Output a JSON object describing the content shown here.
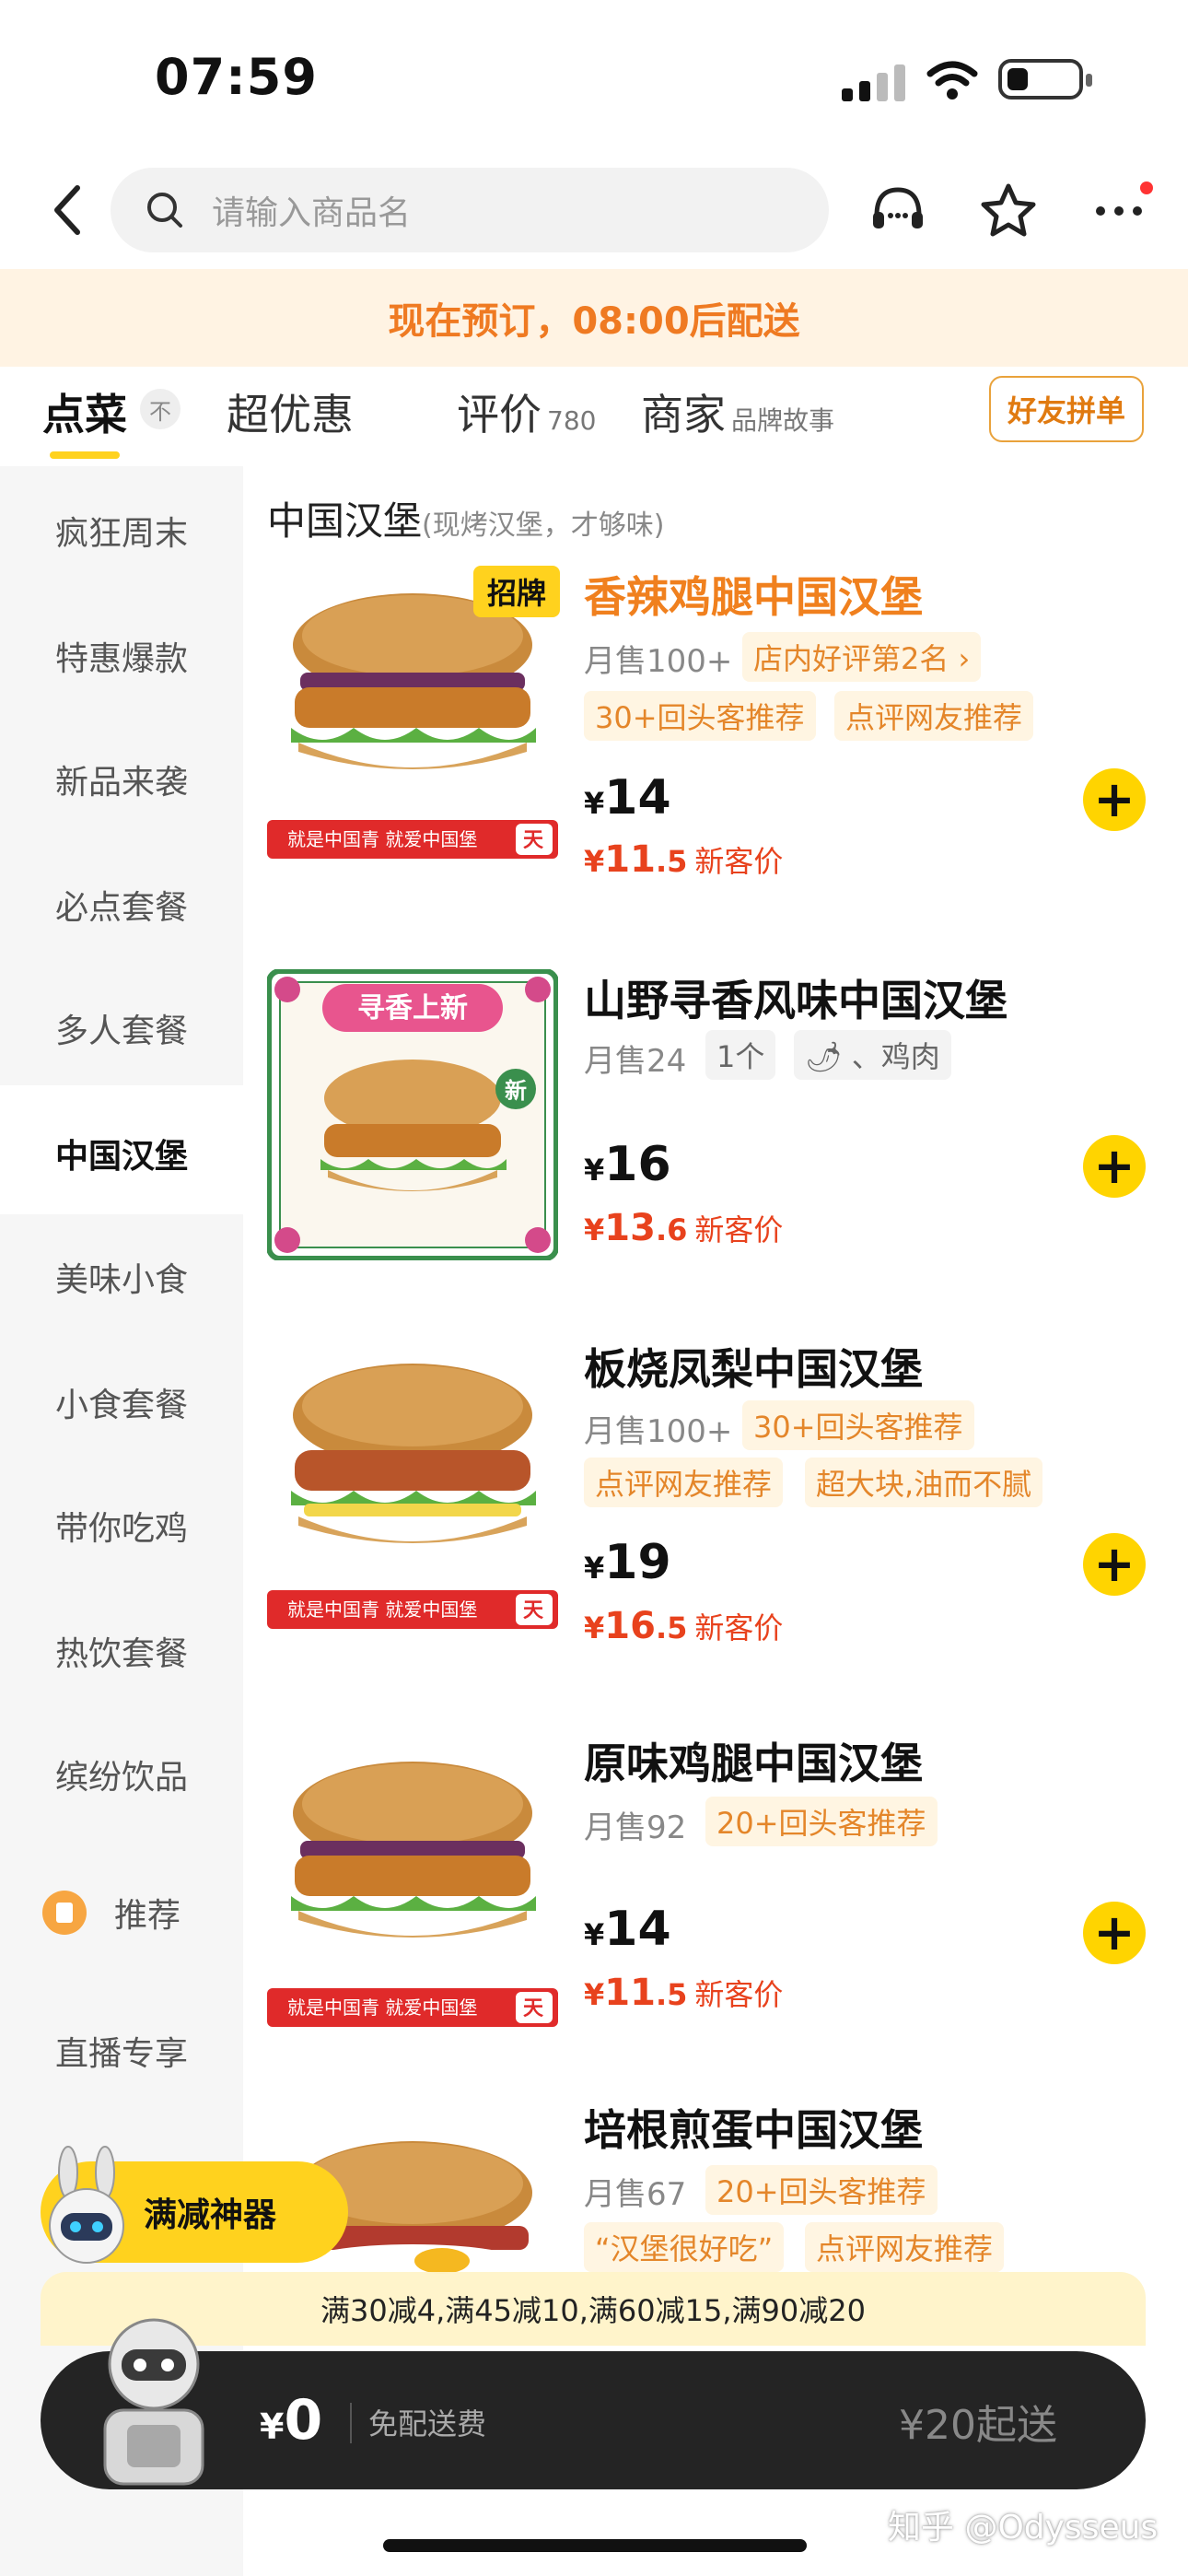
{
  "status_bar": {
    "time": "07:59"
  },
  "search": {
    "placeholder": "请输入商品名"
  },
  "banner": {
    "text": "现在预订，08:00后配送"
  },
  "tabs": [
    {
      "label": "点菜"
    },
    {
      "label": "超优惠"
    },
    {
      "label": "评价",
      "count": "780"
    },
    {
      "label": "商家",
      "sub": "品牌故事"
    }
  ],
  "friend_order": "好友拼单",
  "top_icon": "不",
  "sidebar": {
    "items": [
      {
        "label": "疯狂周末"
      },
      {
        "label": "特惠爆款"
      },
      {
        "label": "新品来袭"
      },
      {
        "label": "必点套餐"
      },
      {
        "label": "多人套餐"
      },
      {
        "label": "中国汉堡"
      },
      {
        "label": "美味小食"
      },
      {
        "label": "小食套餐"
      },
      {
        "label": "带你吃鸡"
      },
      {
        "label": "热饮套餐"
      },
      {
        "label": "缤纷饮品"
      },
      {
        "label": "推荐"
      },
      {
        "label": "直播专享"
      }
    ],
    "active": "中国汉堡"
  },
  "section": {
    "title": "中国汉堡",
    "subtitle": "(现烤汉堡，才够味)"
  },
  "ribbon": {
    "text": "就是中国青 就爱中国堡",
    "badge": "天"
  },
  "new_card": {
    "header": "寻香上新",
    "badge": "新"
  },
  "products": [
    {
      "badge": "招牌",
      "name": "香辣鸡腿中国汉堡",
      "sales": "月售100+",
      "tags": [
        "店内好评第2名 ›",
        "30+回头客推荐",
        "点评网友推荐"
      ],
      "currency": "¥",
      "price": "14",
      "new_price_int": "11",
      "new_price_dec": ".5",
      "new_label": "新客价"
    },
    {
      "name": "山野寻香风味中国汉堡",
      "sales": "月售24",
      "tags": [
        "1个",
        "🌶 、鸡肉"
      ],
      "currency": "¥",
      "price": "16",
      "new_price_int": "13",
      "new_price_dec": ".6",
      "new_label": "新客价"
    },
    {
      "name": "板烧凤梨中国汉堡",
      "sales": "月售100+",
      "tags": [
        "30+回头客推荐",
        "点评网友推荐",
        "超大块,油而不腻"
      ],
      "currency": "¥",
      "price": "19",
      "new_price_int": "16",
      "new_price_dec": ".5",
      "new_label": "新客价"
    },
    {
      "name": "原味鸡腿中国汉堡",
      "sales": "月售92",
      "tags": [
        "20+回头客推荐"
      ],
      "currency": "¥",
      "price": "14",
      "new_price_int": "11",
      "new_price_dec": ".5",
      "new_label": "新客价"
    },
    {
      "name": "培根煎蛋中国汉堡",
      "sales": "月售67",
      "tags": [
        "20+回头客推荐",
        "“汉堡很好吃”",
        "点评网友推荐"
      ]
    }
  ],
  "promo": {
    "text": "满30减4,满45减10,满60减15,满90减20"
  },
  "discount_tool": "满减神器",
  "cart": {
    "currency": "¥",
    "amount": "0",
    "fee": "免配送费",
    "min": "¥20起送"
  },
  "watermark": "知乎 @Odysseus",
  "colors": {
    "accent": "#ffd400",
    "orange": "#f0801e",
    "red": "#e8421d"
  }
}
